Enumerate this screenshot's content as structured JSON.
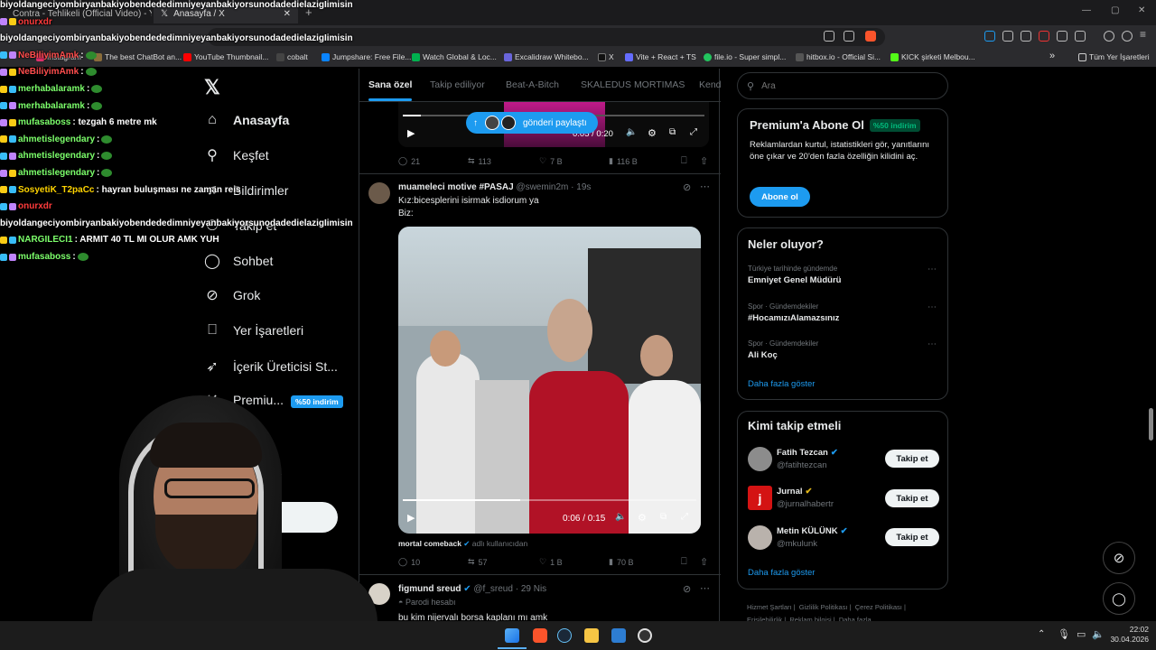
{
  "browser": {
    "tabs": [
      {
        "label": "Contra - Tehlikeli (Official Video) - Yo"
      },
      {
        "label": "Anasayfa / X"
      }
    ],
    "new_tab": "+",
    "window_controls": [
      "—",
      "▢",
      "✕"
    ],
    "bookmarks": [
      {
        "label": "Instagram",
        "color": "#e1306c"
      },
      {
        "label": "The best ChatBot an...",
        "color": "#8a6d3b"
      },
      {
        "label": "YouTube Thumbnail...",
        "color": "#ff0000"
      },
      {
        "label": "cobalt",
        "color": "#444"
      },
      {
        "label": "Jumpshare: Free File...",
        "color": "#0a84ff"
      },
      {
        "label": "Watch Global & Loc...",
        "color": "#00b14f"
      },
      {
        "label": "Excalidraw Whitebo...",
        "color": "#6965db"
      },
      {
        "label": "X",
        "color": "#111"
      },
      {
        "label": "Vite + React + TS",
        "color": "#646cff"
      },
      {
        "label": "file.io - Super simpl...",
        "color": "#22c55e"
      },
      {
        "label": "hitbox.io - Official Si...",
        "color": "#555"
      },
      {
        "label": "KICK şirketi Melbou...",
        "color": "#53fc18"
      }
    ],
    "bookmarks_more": "»",
    "all_bookmarks": "Tüm Yer İşaretleri"
  },
  "chat": [
    {
      "user": "biyoldangeciyombiryanbakiyobendededimniyeyanbakiyorsunodadedielazigIimisin",
      "msg": "",
      "color": "#ffffff"
    },
    {
      "user": "onurxdr",
      "msg": "",
      "color": "#ff3b3b"
    },
    {
      "user": "biyoldangeciyombiryanbakiyobendededimniyeyanbakiyorsunodadedielazigIimisin",
      "msg": "",
      "color": "#ffffff"
    },
    {
      "user": "NeBiliyimAmk",
      "msg": ":",
      "color": "#ff4d4d"
    },
    {
      "user": "NeBiliyimAmk",
      "msg": ":",
      "color": "#ff4d4d"
    },
    {
      "user": "merhabalaramk",
      "msg": ":",
      "color": "#7cff6b"
    },
    {
      "user": "merhabalaramk",
      "msg": ":",
      "color": "#7cff6b"
    },
    {
      "user": "mufasaboss",
      "msg": ": tezgah 6 metre mk",
      "color": "#7cff6b"
    },
    {
      "user": "ahmetislegendary",
      "msg": ":",
      "color": "#7cff6b"
    },
    {
      "user": "ahmetislegendary",
      "msg": ":",
      "color": "#7cff6b"
    },
    {
      "user": "ahmetislegendary",
      "msg": ":",
      "color": "#7cff6b"
    },
    {
      "user": "SosyetiK_T2paCc",
      "msg": ": hayran buluşması ne zaman reis",
      "color": "#ffd400"
    },
    {
      "user": "onurxdr",
      "msg": "",
      "color": "#ff3b3b"
    },
    {
      "user": "biyoldangeciyombiryanbakiyobendededimniyeyanbakiyorsunodadedielazigIimisin",
      "msg": "",
      "color": "#ffffff"
    },
    {
      "user": "NARGILECI1",
      "msg": ": ARMIT 40 TL MI OLUR AMK YUH",
      "color": "#7cff6b"
    },
    {
      "user": "mufasaboss",
      "msg": ":",
      "color": "#7cff6b"
    }
  ],
  "nav": [
    {
      "label": "Anasayfa",
      "icon": "home-icon",
      "glyph": "⌂"
    },
    {
      "label": "Keşfet",
      "icon": "search-icon",
      "glyph": "⚲"
    },
    {
      "label": "Bildirimler",
      "icon": "bell-icon",
      "glyph": "♫"
    },
    {
      "label": "Takip et",
      "icon": "add-user-icon",
      "glyph": "⚇"
    },
    {
      "label": "Sohbet",
      "icon": "chat-icon",
      "glyph": "◯"
    },
    {
      "label": "Grok",
      "icon": "grok-icon",
      "glyph": "⊘"
    },
    {
      "label": "Yer İşaretleri",
      "icon": "bookmark-icon",
      "glyph": "⎕"
    },
    {
      "label": "İçerik Üreticisi St...",
      "icon": "rocket-icon",
      "glyph": "➶"
    },
    {
      "label": "Premiu...",
      "icon": "premium-icon",
      "glyph": "✕"
    },
    {
      "label": "azla",
      "icon": "more-icon",
      "glyph": "…"
    }
  ],
  "nav_premium_badge": "%50 indirim",
  "feed": {
    "tabs": [
      "Sana özel",
      "Takip ediliyor",
      "Beat-A-Bitch",
      "SKALEDUS MORTIMAS",
      "Kend"
    ],
    "share_pill": "gönderi paylaştı",
    "top_video_time": "0:05 / 0:20",
    "post0_stats": {
      "replies": "21",
      "reposts": "113",
      "likes": "7 B",
      "views": "116 B"
    },
    "post1": {
      "name": "muameleci motive #PASAJ",
      "handle": "@swemin2m",
      "time": "19s",
      "text1": "Kız:bicesplerini isirmak isdiorum ya",
      "text2": "Biz:",
      "video_time": "0:06 / 0:15",
      "quote_name": "mortal comeback",
      "quote_sub": "adlı kullanıcıdan",
      "stats": {
        "replies": "10",
        "reposts": "57",
        "likes": "1 B",
        "views": "70 B"
      }
    },
    "post2": {
      "name": "figmund sreud",
      "handle": "@f_sreud",
      "time": "29 Nis",
      "label": "Parodi hesabı",
      "text": "bu kim nijervalı borsa kaplanı mı amk"
    }
  },
  "search": {
    "placeholder": "Ara"
  },
  "premium_card": {
    "title": "Premium'a Abone Ol",
    "badge": "%50 indirim",
    "text": "Reklamlardan kurtul, istatistikleri gör, yanıtlarını öne çıkar ve 20'den fazla özelliğin kilidini aç.",
    "button": "Abone ol"
  },
  "trends": {
    "title": "Neler oluyor?",
    "items": [
      {
        "context": "Türkiye tarihinde gündemde",
        "name": "Emniyet Genel Müdürü"
      },
      {
        "context": "Spor · Gündemdekiler",
        "name": "#HocamızıAlamazsınız"
      },
      {
        "context": "Spor · Gündemdekiler",
        "name": "Ali Koç"
      }
    ],
    "more": "Daha fazla göster"
  },
  "who_to_follow": {
    "title": "Kimi takip etmeli",
    "users": [
      {
        "name": "Fatih Tezcan",
        "handle": "@fatihtezcan",
        "button": "Takip et",
        "verify": "#1d9bf0"
      },
      {
        "name": "Jurnal",
        "handle": "@jurnalhabertr",
        "button": "Takip et",
        "verify": "#e2b719"
      },
      {
        "name": "Metin KÜLÜNK",
        "handle": "@mkulunk",
        "button": "Takip et",
        "verify": "#1d9bf0"
      }
    ],
    "more": "Daha fazla göster"
  },
  "footer_links": [
    "Hizmet Şartları",
    "Gizlilik Politikası",
    "Çerez Politikası",
    "Erişilebilirlik",
    "Reklam bilgisi",
    "Daha fazla ..."
  ],
  "taskbar": {
    "time": "22:02",
    "date": "30.04.2026"
  },
  "colors": {
    "accent": "#1d9bf0",
    "premium_green": "#00ba7c",
    "bg": "#000000"
  }
}
